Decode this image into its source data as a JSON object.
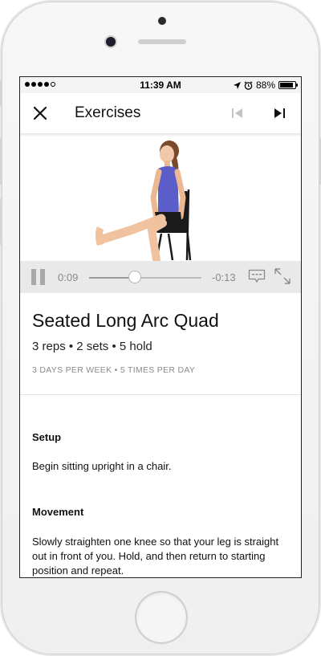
{
  "status_bar": {
    "time": "11:39 AM",
    "battery": "88%"
  },
  "app_bar": {
    "title": "Exercises"
  },
  "video": {
    "elapsed": "0:09",
    "remaining": "-0:13",
    "progress": 0.41
  },
  "exercise": {
    "name": "Seated Long Arc Quad",
    "prescription": "3 reps • 2 sets • 5 hold",
    "frequency": "3 DAYS PER WEEK • 5 TIMES PER DAY",
    "sections": [
      {
        "heading": "Setup",
        "text": "Begin sitting upright in a chair."
      },
      {
        "heading": "Movement",
        "text": "Slowly straighten one knee so that your leg is straight out in front of you. Hold, and then return to starting position and repeat."
      }
    ]
  },
  "colors": {
    "control_bar": "#e9e9e9",
    "shirt": "#5b5ec9",
    "chair": "#1a1a1a"
  }
}
